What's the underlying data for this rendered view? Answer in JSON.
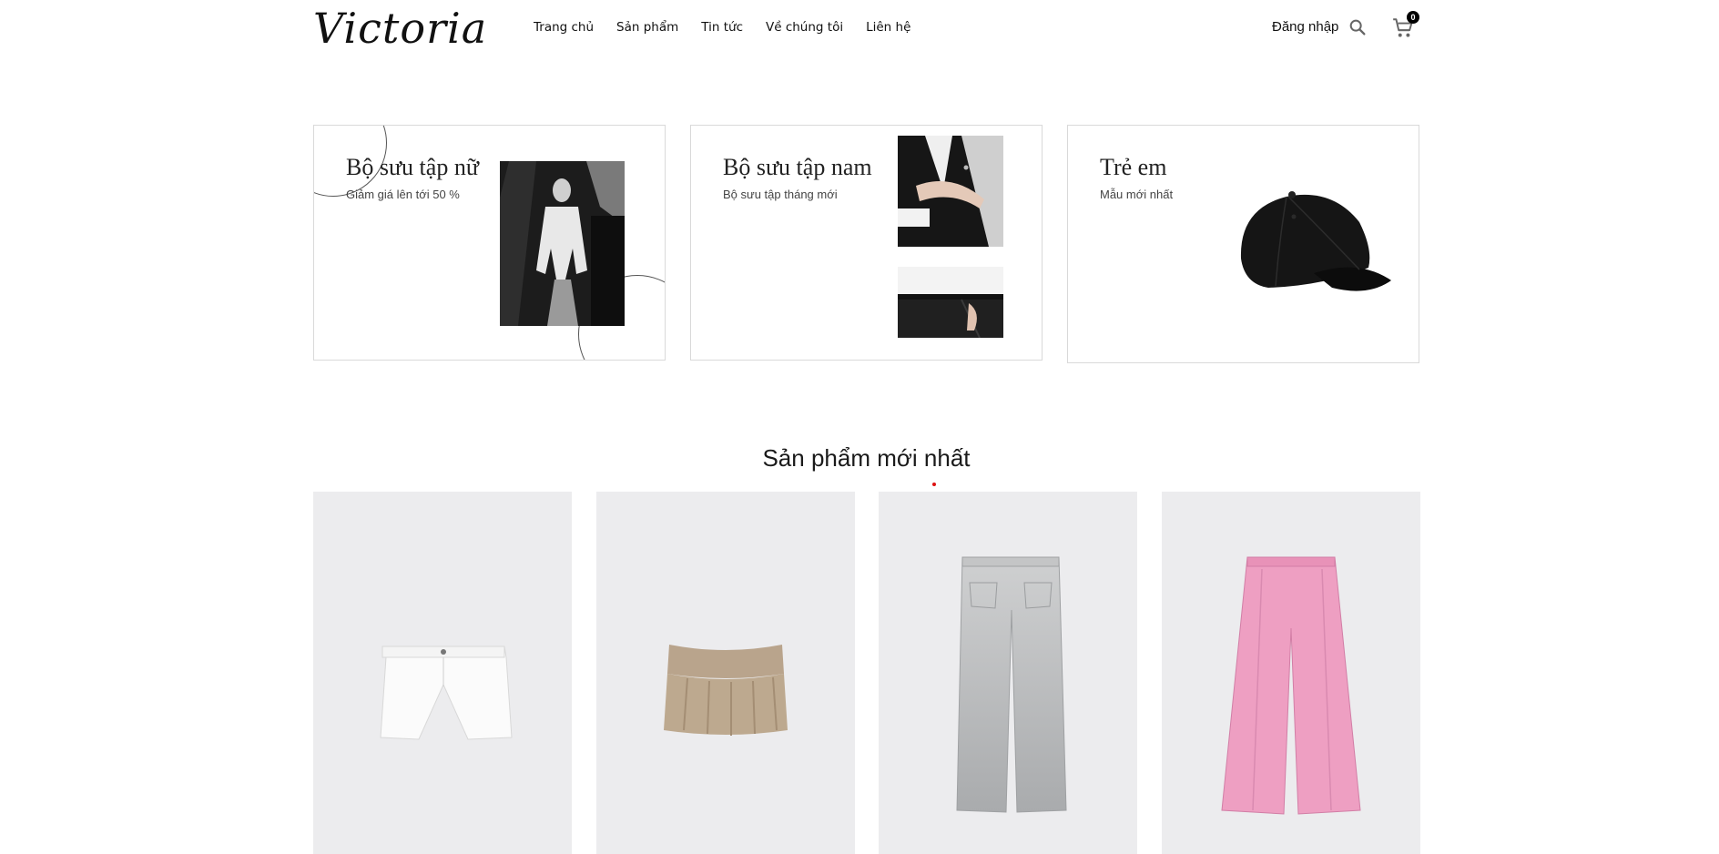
{
  "header": {
    "logo": "Victoria",
    "nav": [
      "Trang chủ",
      "Sản phẩm",
      "Tin tức",
      "Về chúng tôi",
      "Liên hệ"
    ],
    "login": "Đăng nhập",
    "cart_count": "0",
    "icons": {
      "search": "search-icon",
      "cart": "cart-icon"
    }
  },
  "collections": [
    {
      "title": "Bộ sưu tập nữ",
      "subtitle": "Giảm giá lên tới 50 %"
    },
    {
      "title": "Bộ sưu tập nam",
      "subtitle": "Bộ sưu tập tháng mới"
    },
    {
      "title": "Trẻ em",
      "subtitle": "Mẫu mới nhất"
    }
  ],
  "section": {
    "title": "Sản phẩm mới nhất",
    "accent": "#dd1111"
  },
  "products": [
    {
      "image": "white-denim-shorts"
    },
    {
      "image": "beige-mini-skirt"
    },
    {
      "image": "grey-wide-jeans"
    },
    {
      "image": "pink-wide-trousers"
    }
  ]
}
